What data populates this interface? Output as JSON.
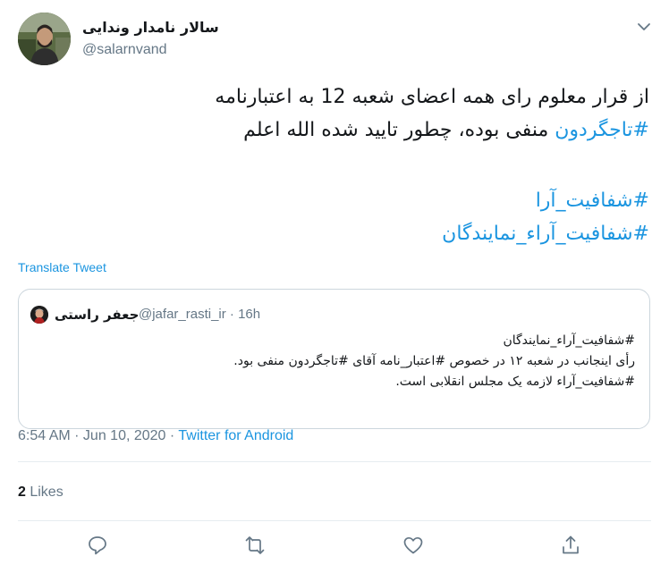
{
  "author": {
    "name": "سالار نامدار وندایی",
    "handle": "@salarnvand"
  },
  "tweet": {
    "line1": "از قرار معلوم رای همه اعضای شعبه 12 به اعتبارنامه",
    "line2_tag": "#تاجگردون",
    "line2_rest": " منفی بوده، چطور تایید شده الله اعلم",
    "tag1": "#شفافیت_آرا",
    "tag2": "#شفافیت_آراء_نمایندگان"
  },
  "translate_label": "Translate Tweet",
  "quoted": {
    "name": "جعفر راستی",
    "handle": "@jafar_rasti_ir · 16h",
    "lines": [
      "#شفافیت_آراء_نمایندگان",
      "رأی اینجانب در شعبه ۱۲ در خصوص #اعتبار_نامه آقای #تاجگردون منفی بود.",
      "#شفافیت_آراء  لازمه یک مجلس انقلابی است."
    ]
  },
  "meta": {
    "time_date": "6:54 AM · Jun 10, 2020 · ",
    "source": "Twitter for Android"
  },
  "likes": {
    "count": "2",
    "label": " Likes"
  },
  "icons": {
    "chevron": "chevron-down-icon",
    "reply": "reply-icon",
    "retweet": "retweet-icon",
    "like": "heart-icon",
    "share": "share-icon"
  },
  "colors": {
    "link": "#1b95e0",
    "secondary": "#657786",
    "border": "#ccd6dd"
  }
}
